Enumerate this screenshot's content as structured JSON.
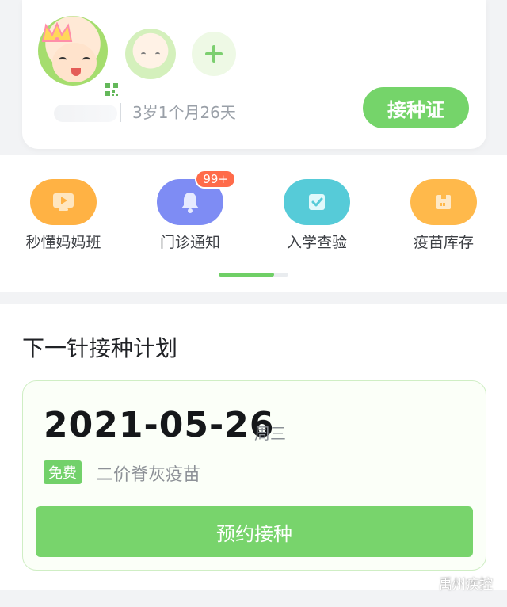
{
  "profile": {
    "child_age": "3岁1个月26天",
    "certificate_button": "接种证"
  },
  "shortcuts": [
    {
      "label": "秒懂妈妈班",
      "icon": "video-icon",
      "color": "#ffb244"
    },
    {
      "label": "门诊通知",
      "icon": "bell-icon",
      "color": "#7e8cf4",
      "badge": "99+"
    },
    {
      "label": "入学查验",
      "icon": "checkbox-icon",
      "color": "#56cbd8"
    },
    {
      "label": "疫苗库存",
      "icon": "box-icon",
      "color": "#ffb94b"
    }
  ],
  "carousel": {
    "active_fraction": 0.8
  },
  "next_plan": {
    "title": "下一针接种计划",
    "date": "2021-05-26",
    "weekday": "周三",
    "tag": "免费",
    "vaccine": "二价脊灰疫苗",
    "button": "预约接种"
  },
  "watermark": {
    "text": "禹州疾控"
  },
  "colors": {
    "accent": "#75d46a",
    "badge": "#ff6b4a"
  }
}
